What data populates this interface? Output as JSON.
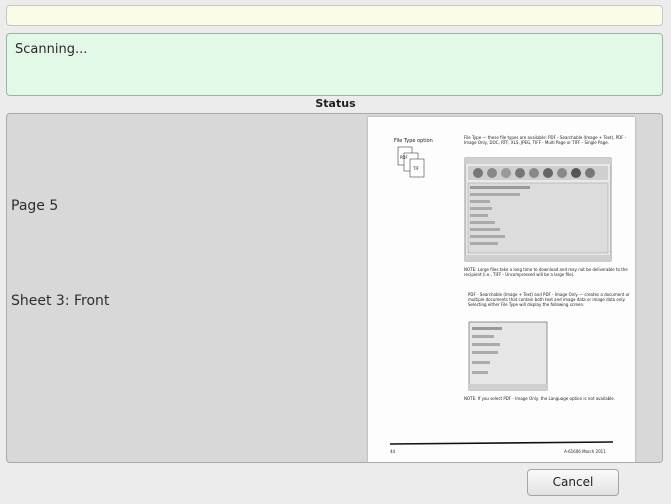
{
  "top_message": "",
  "scan_status": "Scanning...",
  "status_title": "Status",
  "current": {
    "page": "Page 5",
    "sheet": "Sheet 3: Front"
  },
  "preview_doc": {
    "side_label": "File Type option",
    "file_icon_labels": [
      "PDF",
      "TIF"
    ],
    "heading": "File Type — these file types are available: PDF - Searchable (Image + Text), PDF - Image Only, DOC, RTF, XLS, JPEG, TIFF - Multi Page or TIFF - Single Page.",
    "note1": "NOTE: Large files take a long time to download and may not be deliverable to the recipient (i.e., TIFF - Uncompressed will be a large file).",
    "bullet": "PDF - Searchable (Image + Text) and PDF - Image Only — creates a document or multiple documents that contain both text and image data or image data only. Selecting either File Type will display the following screen.",
    "note2": "NOTE: If you select PDF - Image Only, the Language option is not available.",
    "footer_left": "44",
    "footer_right": "A-61606 March 2011"
  },
  "buttons": {
    "cancel": "Cancel"
  }
}
